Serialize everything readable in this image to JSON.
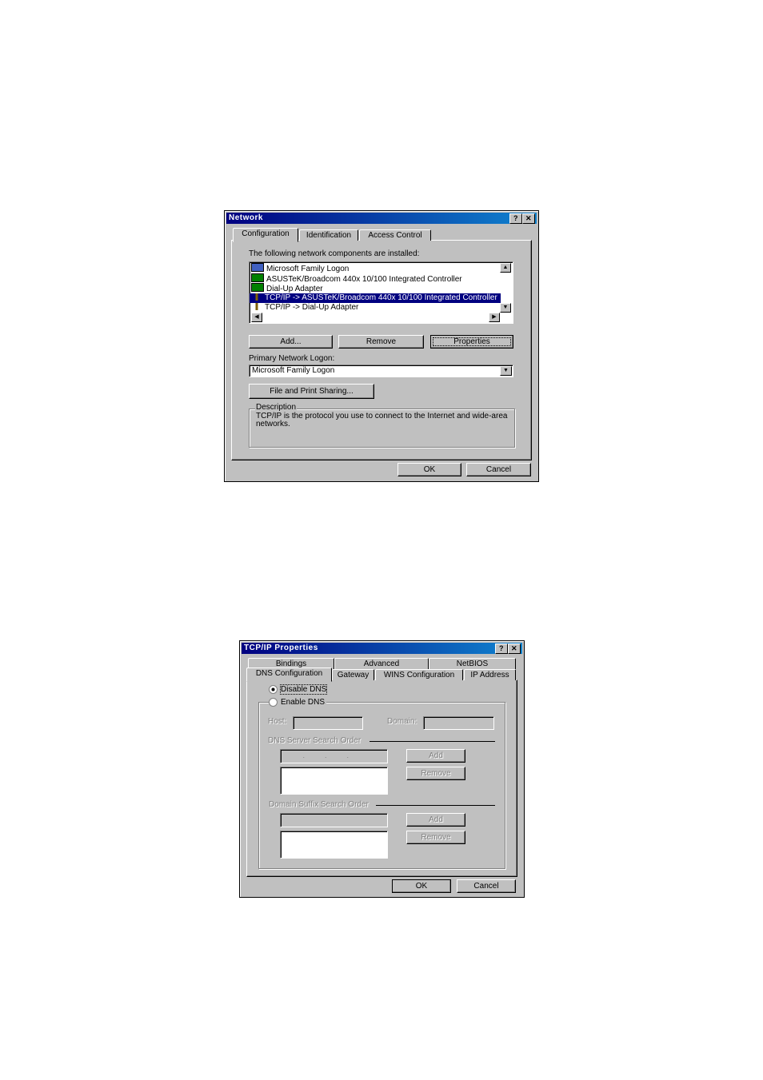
{
  "network": {
    "title": "Network",
    "tabs": [
      "Configuration",
      "Identification",
      "Access Control"
    ],
    "components_label": "The following network components are installed:",
    "components": [
      {
        "label": "Microsoft Family Logon",
        "icon": "client-icon",
        "selected": false
      },
      {
        "label": "ASUSTeK/Broadcom 440x 10/100 Integrated Controller",
        "icon": "adapter-icon",
        "selected": false
      },
      {
        "label": "Dial-Up Adapter",
        "icon": "adapter-icon",
        "selected": false
      },
      {
        "label": "TCP/IP -> ASUSTeK/Broadcom 440x 10/100 Integrated Controller",
        "icon": "protocol-icon",
        "selected": true
      },
      {
        "label": "TCP/IP -> Dial-Up Adapter",
        "icon": "protocol-icon",
        "selected": false
      }
    ],
    "add": "Add...",
    "remove": "Remove",
    "properties": "Properties",
    "primary_logon_label": "Primary Network Logon:",
    "primary_logon_value": "Microsoft Family Logon",
    "file_print": "File and Print Sharing...",
    "description_label": "Description",
    "description_text": "TCP/IP is the protocol you use to connect to the Internet and wide-area networks.",
    "ok": "OK",
    "cancel": "Cancel"
  },
  "tcpip": {
    "title": "TCP/IP Properties",
    "tabs_row1": [
      "Bindings",
      "Advanced",
      "NetBIOS"
    ],
    "tabs_row2": [
      "DNS Configuration",
      "Gateway",
      "WINS Configuration",
      "IP Address"
    ],
    "disable_dns": "Disable DNS",
    "enable_dns": "Enable DNS",
    "dns_mode": "disable",
    "host": "Host:",
    "domain": "Domain:",
    "dns_order": "DNS Server Search Order",
    "suffix_order": "Domain Suffix Search Order",
    "add": "Add",
    "remove": "Remove",
    "ok": "OK",
    "cancel": "Cancel"
  }
}
